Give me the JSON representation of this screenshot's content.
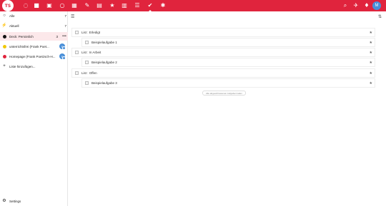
{
  "colors": {
    "brand": "#e0243d",
    "accent": "#4a90d9"
  },
  "topbar": {
    "logo_text": "TS",
    "apps": [
      {
        "icon": "dashboard-icon",
        "glyph": "◌"
      },
      {
        "icon": "files-icon",
        "glyph": "■"
      },
      {
        "icon": "photos-icon",
        "glyph": "▣"
      },
      {
        "icon": "search-icon",
        "glyph": "○"
      },
      {
        "icon": "calendar-icon",
        "glyph": "▦"
      },
      {
        "icon": "notes-icon",
        "glyph": "✎"
      },
      {
        "icon": "mail-icon",
        "glyph": "▤"
      },
      {
        "icon": "favorites-icon",
        "glyph": "★"
      },
      {
        "icon": "activity-icon",
        "glyph": "▥"
      },
      {
        "icon": "deck-icon",
        "glyph": "☰"
      },
      {
        "icon": "tasks-icon",
        "glyph": "✔"
      },
      {
        "icon": "settings-app-icon",
        "glyph": "✱"
      }
    ],
    "right_icons": [
      {
        "icon": "search-icon",
        "glyph": "⌕"
      },
      {
        "icon": "notifications-icon",
        "glyph": "✈"
      },
      {
        "icon": "contacts-icon",
        "glyph": "♦"
      }
    ],
    "avatar_initial": "M"
  },
  "sidebar": {
    "items": [
      {
        "label": "Alle",
        "count": "7",
        "icon": "circle-icon",
        "glyph": "○"
      },
      {
        "label": "Aktuell",
        "count": "7",
        "icon": "activity-icon",
        "glyph": "⚡"
      },
      {
        "label": "Deck: Persönlich",
        "count": "3",
        "more": "•••",
        "dot": "#111111"
      },
      {
        "label": "unterrichtsfrei (Frank Poet...",
        "dot": "#f0c808",
        "share": "F"
      },
      {
        "label": "Homepage (Frank Poetzsch-H...",
        "dot": "#e0243d",
        "share": "F"
      },
      {
        "label": "Liste hinzufügen...",
        "icon": "plus-icon",
        "glyph": "+"
      }
    ],
    "settings_label": "Settings",
    "settings_glyph": "⚙"
  },
  "main": {
    "menu_glyph": "☰",
    "sort_glyph": "⇅",
    "star_glyph": "★",
    "rows": [
      {
        "label": "List : Erledigt",
        "level": 0
      },
      {
        "label": "Beispielaufgabe 1",
        "level": 1
      },
      {
        "label": "List : In Arbeit",
        "level": 0
      },
      {
        "label": "Beispielaufgabe 2",
        "level": 1
      },
      {
        "label": "List : Offen",
        "level": 0
      },
      {
        "label": "Beispielaufgabe 3",
        "level": 1
      }
    ],
    "hint": "Alle abgeschlossenen Aufgaben laden"
  }
}
